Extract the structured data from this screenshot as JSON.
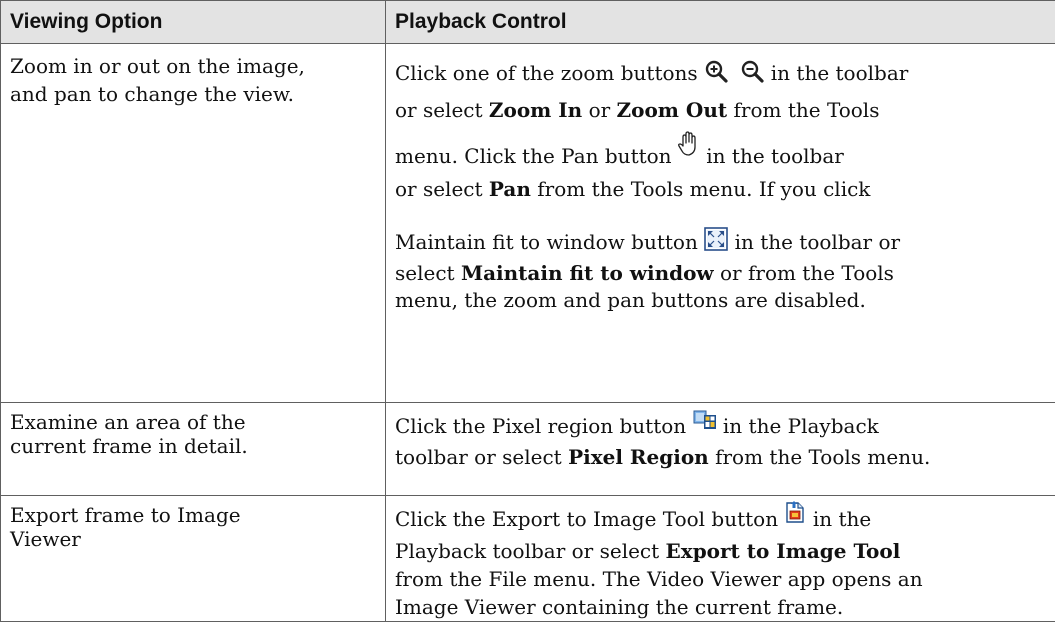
{
  "table": {
    "headers": [
      "Viewing Option",
      "Playback Control"
    ],
    "rows": [
      {
        "option_lines": [
          "Zoom in or out on the image,",
          "and pan to change the view."
        ],
        "control": {
          "l1a": "Click one of the zoom buttons",
          "l1b": "in the toolbar",
          "l2a": "or select",
          "l2b": "Zoom In",
          "l2c": "or",
          "l2d": "Zoom Out",
          "l2e": "from the Tools",
          "l3a": "menu. Click the Pan button",
          "l3b": "in the toolbar",
          "l4a": "or select",
          "l4b": "Pan",
          "l4c": "from the Tools menu. If you click",
          "l5a": "Maintain fit to window button",
          "l5b": "in the toolbar or",
          "l6a": "select",
          "l6b": "Maintain fit to window",
          "l6c": "or from the Tools",
          "l7": "menu, the zoom and pan buttons are disabled."
        }
      },
      {
        "option_lines": [
          "Examine an area of the",
          "current frame in detail."
        ],
        "control": {
          "l1a": "Click the Pixel region button",
          "l1b": "in the Playback",
          "l2a": "toolbar or select",
          "l2b": "Pixel Region",
          "l2c": "from the Tools menu."
        }
      },
      {
        "option_lines": [
          "Export frame to Image",
          "Viewer"
        ],
        "control": {
          "l1a": "Click the Export to Image Tool button",
          "l1b": "in the",
          "l2a": "Playback toolbar or select",
          "l2b": "Export to Image Tool",
          "l3": "from the File menu. The Video Viewer app opens an",
          "l4": "Image Viewer containing the current frame."
        }
      }
    ]
  },
  "icons": [
    "zoom-in-icon",
    "zoom-out-icon",
    "pan-hand-icon",
    "fit-to-window-icon",
    "pixel-region-icon",
    "export-to-image-icon"
  ]
}
